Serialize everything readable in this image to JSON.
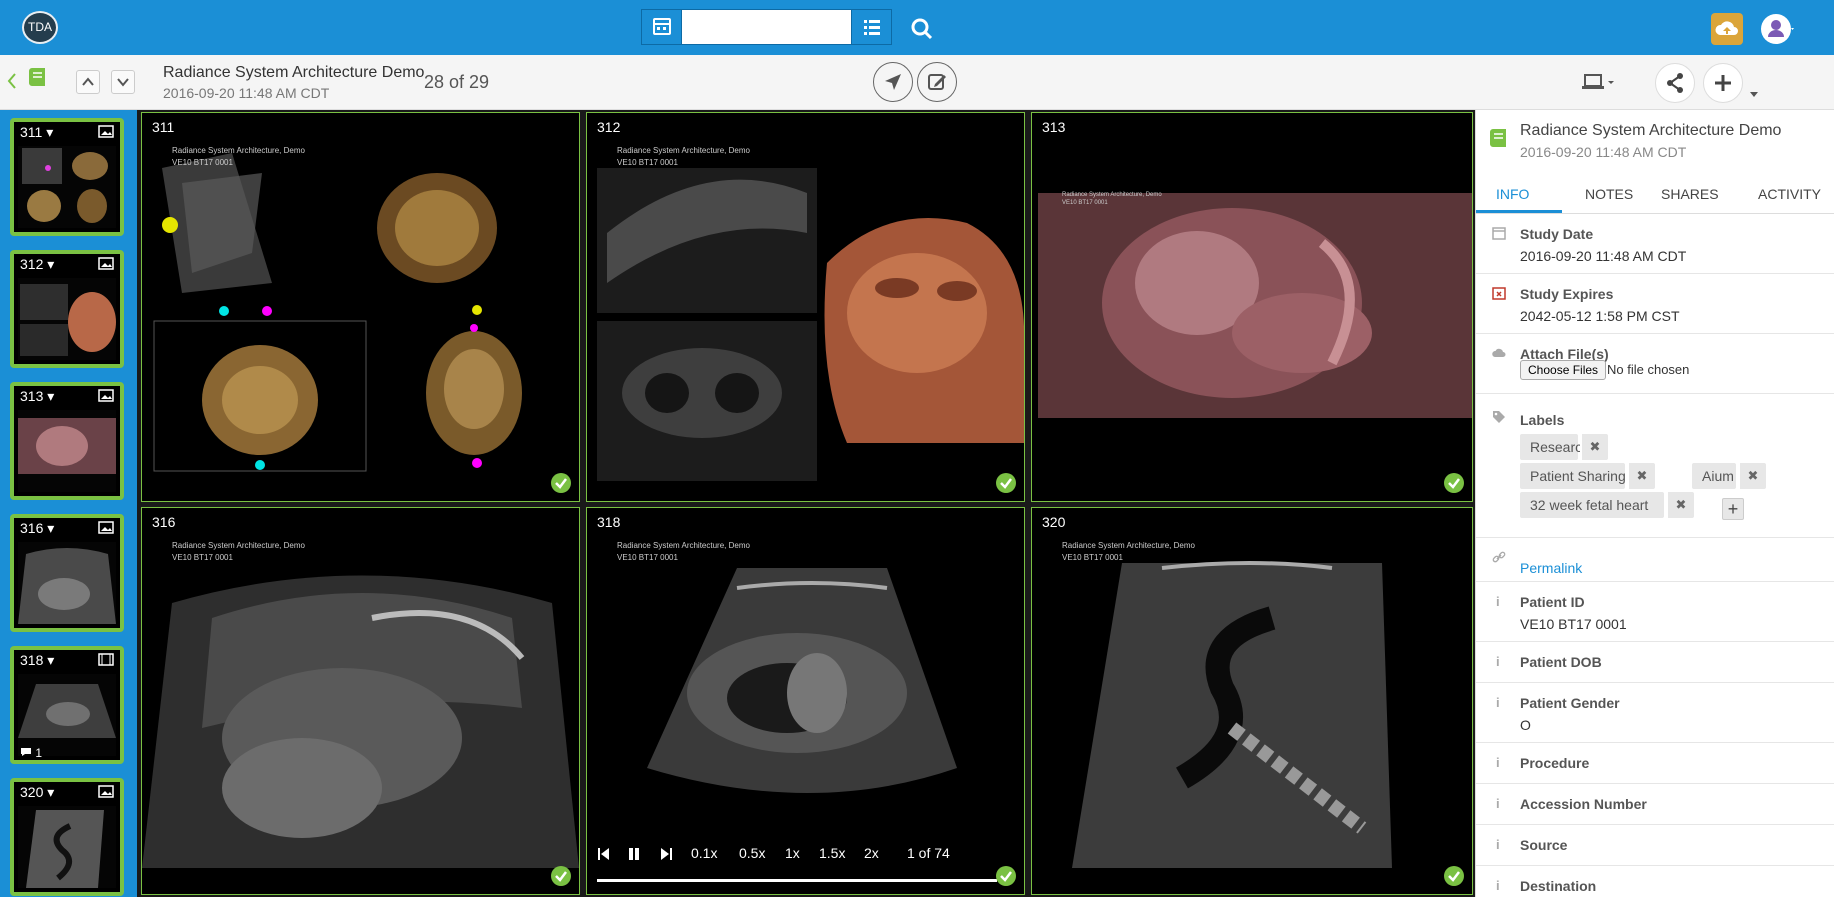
{
  "topbar": {
    "logo_text": "TDA",
    "search_placeholder": "",
    "icons": [
      "calendar-icon",
      "list-icon",
      "search-icon",
      "cloud-upload-icon",
      "user-icon"
    ],
    "accent": "#1b8fd6"
  },
  "subbar": {
    "study_title": "Radiance System Architecture Demo",
    "study_date": "2016-09-20 11:48 AM CDT",
    "position": "28 of 29"
  },
  "thumbnails": [
    {
      "label": "311",
      "kind": "image"
    },
    {
      "label": "312",
      "kind": "image"
    },
    {
      "label": "313",
      "kind": "image"
    },
    {
      "label": "316",
      "kind": "image"
    },
    {
      "label": "318",
      "kind": "video",
      "comments": "1"
    },
    {
      "label": "320",
      "kind": "image"
    }
  ],
  "panels": [
    {
      "num": "311",
      "header": "Radiance System Architecture, Demo",
      "sub": "VE10 BT17 0001"
    },
    {
      "num": "312",
      "header": "Radiance System Architecture, Demo",
      "sub": "VE10 BT17 0001"
    },
    {
      "num": "313",
      "header": "Radiance System Architecture, Demo",
      "sub": "VE10 BT17 0001"
    },
    {
      "num": "316",
      "header": "Radiance System Architecture, Demo",
      "sub": "VE10 BT17 0001"
    },
    {
      "num": "318",
      "header": "Radiance System Architecture, Demo",
      "sub": "VE10 BT17 0001"
    },
    {
      "num": "320",
      "header": "Radiance System Architecture, Demo",
      "sub": "VE10 BT17 0001"
    }
  ],
  "player": {
    "speeds": [
      "0.1x",
      "0.5x",
      "1x",
      "1.5x",
      "2x"
    ],
    "frame": "1 of 74",
    "progress": 1.0
  },
  "info": {
    "title": "Radiance System Architecture Demo",
    "date": "2016-09-20 11:48 AM CDT",
    "tabs": [
      "INFO",
      "NOTES",
      "SHARES",
      "ACTIVITY"
    ],
    "study_date_label": "Study Date",
    "study_date": "2016-09-20 11:48 AM CDT",
    "expires_label": "Study Expires",
    "expires": "2042-05-12 1:58 PM CST",
    "attach_label": "Attach File(s)",
    "choose_files": "Choose Files",
    "no_file": "No file chosen",
    "labels_label": "Labels",
    "labels": [
      "Research",
      "Patient Sharing",
      "Aium",
      "32 week fetal heart"
    ],
    "permalink": "Permalink",
    "patient_id_label": "Patient ID",
    "patient_id": "VE10 BT17 0001",
    "dob_label": "Patient DOB",
    "gender_label": "Patient Gender",
    "gender": "O",
    "procedure_label": "Procedure",
    "accession_label": "Accession Number",
    "source_label": "Source",
    "destination_label": "Destination"
  }
}
